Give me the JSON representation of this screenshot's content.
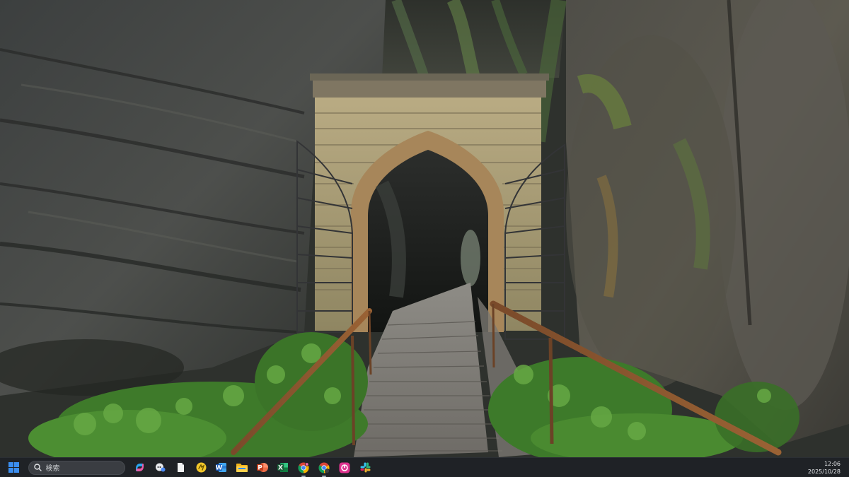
{
  "desktop": {
    "wallpaper": "Rock gateway tunnel with wooden boardwalk and iron gates"
  },
  "taskbar": {
    "search_label": "検索",
    "apps": [
      {
        "name": "copilot-icon"
      },
      {
        "name": "chat-icon"
      },
      {
        "name": "file-icon"
      },
      {
        "name": "app-yellow-icon"
      },
      {
        "name": "word-icon",
        "glyph": "W"
      },
      {
        "name": "file-explorer-icon"
      },
      {
        "name": "powerpoint-icon",
        "glyph": "P"
      },
      {
        "name": "excel-icon",
        "glyph": "X"
      },
      {
        "name": "chrome-icon"
      },
      {
        "name": "chrome-profile-icon"
      },
      {
        "name": "app-pink-icon"
      },
      {
        "name": "slack-icon"
      }
    ],
    "clock": {
      "time": "12:06",
      "date": "2025/10/28"
    }
  },
  "colors": {
    "taskbar_bg": "#1f2226",
    "accent_blue": "#3b8ef0"
  }
}
